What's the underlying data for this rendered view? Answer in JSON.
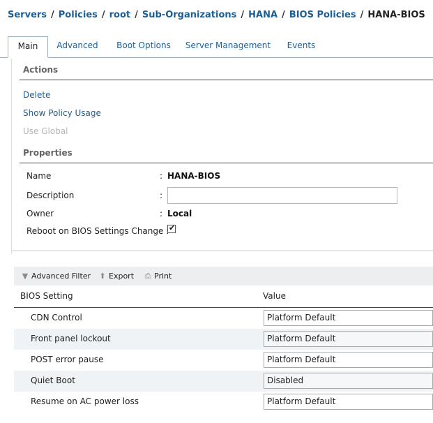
{
  "breadcrumb": {
    "items": [
      "Servers",
      "Policies",
      "root",
      "Sub-Organizations",
      "HANA",
      "BIOS Policies"
    ],
    "current": "HANA-BIOS",
    "separator": "/"
  },
  "tabs": [
    {
      "label": "Main",
      "active": true
    },
    {
      "label": "Advanced",
      "active": false
    },
    {
      "label": "Boot Options",
      "active": false
    },
    {
      "label": "Server Management",
      "active": false
    },
    {
      "label": "Events",
      "active": false
    }
  ],
  "actions": {
    "title": "Actions",
    "delete": "Delete",
    "show_usage": "Show Policy Usage",
    "use_global": "Use Global"
  },
  "properties": {
    "title": "Properties",
    "name_label": "Name",
    "name_value": "HANA-BIOS",
    "description_label": "Description",
    "description_value": "",
    "owner_label": "Owner",
    "owner_value": "Local",
    "reboot_label": "Reboot on BIOS Settings Change",
    "reboot_checked": true,
    "colon": ":"
  },
  "toolbar": {
    "filter": "Advanced Filter",
    "export": "Export",
    "print": "Print"
  },
  "table": {
    "col_setting": "BIOS Setting",
    "col_value": "Value",
    "rows": [
      {
        "setting": "CDN Control",
        "value": "Platform Default"
      },
      {
        "setting": "Front panel lockout",
        "value": "Platform Default"
      },
      {
        "setting": "POST error pause",
        "value": "Platform Default"
      },
      {
        "setting": "Quiet Boot",
        "value": "Disabled"
      },
      {
        "setting": "Resume on AC power loss",
        "value": "Platform Default"
      }
    ]
  },
  "colors": {
    "link": "#1d5f94",
    "disabled": "#b5b5b5",
    "alt_row": "#f0f3f6",
    "toolbar_bg": "#eceef0"
  }
}
